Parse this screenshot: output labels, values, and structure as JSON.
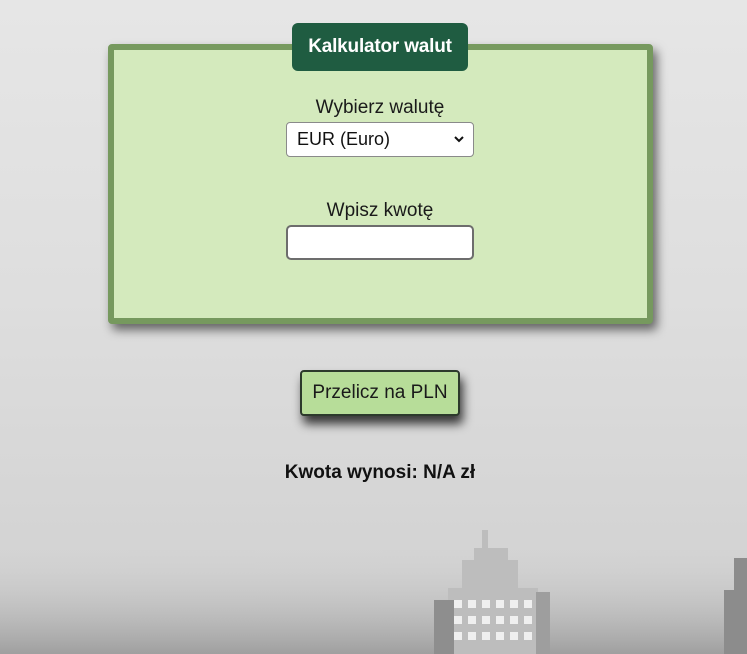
{
  "title": "Kalkulator walut",
  "currency": {
    "label": "Wybierz walutę",
    "selected": "EUR (Euro)"
  },
  "amount": {
    "label": "Wpisz kwotę",
    "value": "",
    "placeholder": ""
  },
  "convert_button": "Przelicz na PLN",
  "result": {
    "prefix": "Kwota wynosi:",
    "value": "N/A",
    "unit": "zł"
  },
  "colors": {
    "panel_bg": "#d4eabd",
    "panel_border": "#76995e",
    "title_bg": "#1f5c41",
    "button_bg": "#b7dd99"
  }
}
